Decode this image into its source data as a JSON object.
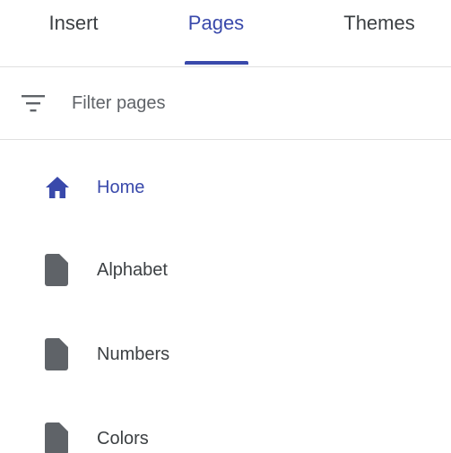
{
  "tabs": [
    {
      "label": "Insert",
      "active": false
    },
    {
      "label": "Pages",
      "active": true
    },
    {
      "label": "Themes",
      "active": false
    }
  ],
  "filter": {
    "placeholder": "Filter pages",
    "value": "",
    "icon": "filter-icon"
  },
  "pages": [
    {
      "label": "Home",
      "icon": "home-icon",
      "active": true
    },
    {
      "label": "Alphabet",
      "icon": "page-icon",
      "active": false
    },
    {
      "label": "Numbers",
      "icon": "page-icon",
      "active": false
    },
    {
      "label": "Colors",
      "icon": "page-icon",
      "active": false
    }
  ],
  "colors": {
    "accent": "#3949ab",
    "text": "#3c4043",
    "muted_text": "#5f6368",
    "icon_grey": "#5f6368",
    "divider": "#e0e0e0"
  }
}
